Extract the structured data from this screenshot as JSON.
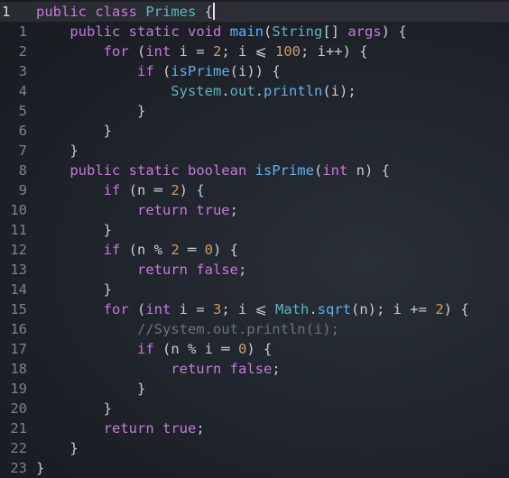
{
  "editor": {
    "language": "java",
    "current_line_index": 0,
    "colors": {
      "background": "#1e2228",
      "keyword": "#c678dd",
      "type": "#56b6c2",
      "function": "#61afef",
      "number": "#d19a66",
      "comment": "#6b717d",
      "text": "#c8ccd4",
      "gutter": "#7b8190"
    },
    "lines": [
      {
        "number": "1",
        "tokens": [
          {
            "text": "public ",
            "kind": "kw"
          },
          {
            "text": "class ",
            "kind": "kw"
          },
          {
            "text": "Primes ",
            "kind": "ty"
          },
          {
            "text": "{",
            "kind": "pl"
          }
        ]
      },
      {
        "number": "1",
        "tokens": [
          {
            "text": "    public ",
            "kind": "kw"
          },
          {
            "text": "static ",
            "kind": "kw"
          },
          {
            "text": "void ",
            "kind": "kw"
          },
          {
            "text": "main",
            "kind": "fn"
          },
          {
            "text": "(",
            "kind": "pl"
          },
          {
            "text": "String",
            "kind": "ty"
          },
          {
            "text": "[] ",
            "kind": "pl"
          },
          {
            "text": "args",
            "kind": "kw"
          },
          {
            "text": ") {",
            "kind": "pl"
          }
        ]
      },
      {
        "number": "2",
        "tokens": [
          {
            "text": "        for ",
            "kind": "kw"
          },
          {
            "text": "(",
            "kind": "pl"
          },
          {
            "text": "int ",
            "kind": "kw"
          },
          {
            "text": "i = ",
            "kind": "pl"
          },
          {
            "text": "2",
            "kind": "num"
          },
          {
            "text": "; i ⩽ ",
            "kind": "pl"
          },
          {
            "text": "100",
            "kind": "num"
          },
          {
            "text": "; i++) {",
            "kind": "pl"
          }
        ]
      },
      {
        "number": "3",
        "tokens": [
          {
            "text": "            if ",
            "kind": "kw"
          },
          {
            "text": "(",
            "kind": "pl"
          },
          {
            "text": "isPrime",
            "kind": "fn"
          },
          {
            "text": "(i)) {",
            "kind": "pl"
          }
        ]
      },
      {
        "number": "4",
        "tokens": [
          {
            "text": "                System",
            "kind": "ty"
          },
          {
            "text": ".",
            "kind": "pl"
          },
          {
            "text": "out",
            "kind": "ty"
          },
          {
            "text": ".",
            "kind": "pl"
          },
          {
            "text": "println",
            "kind": "fn"
          },
          {
            "text": "(i);",
            "kind": "pl"
          }
        ]
      },
      {
        "number": "5",
        "tokens": [
          {
            "text": "            }",
            "kind": "pl"
          }
        ]
      },
      {
        "number": "6",
        "tokens": [
          {
            "text": "        }",
            "kind": "pl"
          }
        ]
      },
      {
        "number": "7",
        "tokens": [
          {
            "text": "    }",
            "kind": "pl"
          }
        ]
      },
      {
        "number": "8",
        "tokens": [
          {
            "text": "    public ",
            "kind": "kw"
          },
          {
            "text": "static ",
            "kind": "kw"
          },
          {
            "text": "boolean ",
            "kind": "kw"
          },
          {
            "text": "isPrime",
            "kind": "fn"
          },
          {
            "text": "(",
            "kind": "pl"
          },
          {
            "text": "int ",
            "kind": "kw"
          },
          {
            "text": "n) {",
            "kind": "pl"
          }
        ]
      },
      {
        "number": "9",
        "tokens": [
          {
            "text": "        if ",
            "kind": "kw"
          },
          {
            "text": "(n ═ ",
            "kind": "pl"
          },
          {
            "text": "2",
            "kind": "num"
          },
          {
            "text": ") {",
            "kind": "pl"
          }
        ]
      },
      {
        "number": "10",
        "tokens": [
          {
            "text": "            return ",
            "kind": "kw"
          },
          {
            "text": "true",
            "kind": "kw"
          },
          {
            "text": ";",
            "kind": "pl"
          }
        ]
      },
      {
        "number": "11",
        "tokens": [
          {
            "text": "        }",
            "kind": "pl"
          }
        ]
      },
      {
        "number": "12",
        "tokens": [
          {
            "text": "        if ",
            "kind": "kw"
          },
          {
            "text": "(n % ",
            "kind": "pl"
          },
          {
            "text": "2",
            "kind": "num"
          },
          {
            "text": " ═ ",
            "kind": "pl"
          },
          {
            "text": "0",
            "kind": "num"
          },
          {
            "text": ") {",
            "kind": "pl"
          }
        ]
      },
      {
        "number": "13",
        "tokens": [
          {
            "text": "            return ",
            "kind": "kw"
          },
          {
            "text": "false",
            "kind": "kw"
          },
          {
            "text": ";",
            "kind": "pl"
          }
        ]
      },
      {
        "number": "14",
        "tokens": [
          {
            "text": "        }",
            "kind": "pl"
          }
        ]
      },
      {
        "number": "15",
        "tokens": [
          {
            "text": "        for ",
            "kind": "kw"
          },
          {
            "text": "(",
            "kind": "pl"
          },
          {
            "text": "int ",
            "kind": "kw"
          },
          {
            "text": "i = ",
            "kind": "pl"
          },
          {
            "text": "3",
            "kind": "num"
          },
          {
            "text": "; i ⩽ ",
            "kind": "pl"
          },
          {
            "text": "Math",
            "kind": "ty"
          },
          {
            "text": ".",
            "kind": "pl"
          },
          {
            "text": "sqrt",
            "kind": "fn"
          },
          {
            "text": "(n); i += ",
            "kind": "pl"
          },
          {
            "text": "2",
            "kind": "num"
          },
          {
            "text": ") {",
            "kind": "pl"
          }
        ]
      },
      {
        "number": "16",
        "tokens": [
          {
            "text": "            //System.out.println(i);",
            "kind": "cm"
          }
        ]
      },
      {
        "number": "17",
        "tokens": [
          {
            "text": "            if ",
            "kind": "kw"
          },
          {
            "text": "(n % i ═ ",
            "kind": "pl"
          },
          {
            "text": "0",
            "kind": "num"
          },
          {
            "text": ") {",
            "kind": "pl"
          }
        ]
      },
      {
        "number": "18",
        "tokens": [
          {
            "text": "                return ",
            "kind": "kw"
          },
          {
            "text": "false",
            "kind": "kw"
          },
          {
            "text": ";",
            "kind": "pl"
          }
        ]
      },
      {
        "number": "19",
        "tokens": [
          {
            "text": "            }",
            "kind": "pl"
          }
        ]
      },
      {
        "number": "20",
        "tokens": [
          {
            "text": "        }",
            "kind": "pl"
          }
        ]
      },
      {
        "number": "21",
        "tokens": [
          {
            "text": "        return ",
            "kind": "kw"
          },
          {
            "text": "true",
            "kind": "kw"
          },
          {
            "text": ";",
            "kind": "pl"
          }
        ]
      },
      {
        "number": "22",
        "tokens": [
          {
            "text": "    }",
            "kind": "pl"
          }
        ]
      },
      {
        "number": "23",
        "tokens": [
          {
            "text": "}",
            "kind": "pl"
          }
        ]
      }
    ]
  }
}
